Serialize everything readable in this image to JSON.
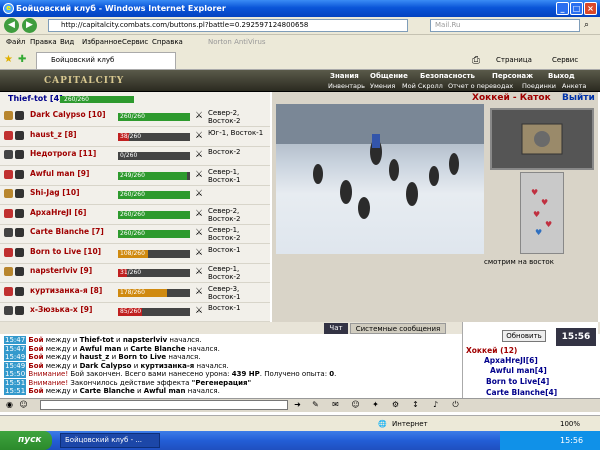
{
  "window": {
    "title": "Бойцовский клуб - Windows Internet Explorer"
  },
  "address": {
    "url": "http://capitalcity.combats.com/buttons.pl?battle=0.292597124800658",
    "search_placeholder": "Mail.Ru"
  },
  "menu": [
    "Файл",
    "Правка",
    "Вид",
    "Избранное",
    "Сервис",
    "Справка"
  ],
  "toolbar": {
    "norton": "Norton AntiVirus",
    "page": "Страница",
    "tools": "Сервис"
  },
  "tab": {
    "label": "Бойцовский клуб"
  },
  "game": {
    "logo": "CAPITALCITY",
    "nav_top": [
      "Знания",
      "Общение",
      "Безопасность",
      "Персонаж",
      "Выход"
    ],
    "nav_sub": [
      "Инвентарь",
      "Умения",
      "Мой Скролл",
      "Отчет о переводах",
      "Поединки",
      "Анкета"
    ],
    "me": {
      "name": "Thief-tot [4]",
      "hp": "260/260"
    },
    "arena_title": "Хоккей - Каток",
    "exit": "Выйти",
    "look": "смотрим на восток",
    "characters": [
      {
        "name": "Dark Calypso [10]",
        "hp": "260/260",
        "fill": 1.0,
        "color": "#2e9a2e",
        "loc": "Севeр-2, Восток-2"
      },
      {
        "name": "haust_z [8]",
        "hp": "38/260",
        "fill": 0.15,
        "color": "#c02020",
        "loc": "Юг-1, Восток-1"
      },
      {
        "name": "Недотрога [11]",
        "hp": "0/260",
        "fill": 0.0,
        "color": "#c02020",
        "loc": "Восток-2"
      },
      {
        "name": "Awful man [9]",
        "hp": "249/260",
        "fill": 0.96,
        "color": "#2e9a2e",
        "loc": "Север-1, Восток-1"
      },
      {
        "name": "Shi-Jag [10]",
        "hp": "260/260",
        "fill": 1.0,
        "color": "#2e9a2e",
        "loc": ""
      },
      {
        "name": "АрхаНreJI [6]",
        "hp": "260/260",
        "fill": 1.0,
        "color": "#2e9a2e",
        "loc": "Север-2, Восток-2"
      },
      {
        "name": "Carte Blanche [7]",
        "hp": "260/260",
        "fill": 1.0,
        "color": "#2e9a2e",
        "loc": "Север-1, Восток-2"
      },
      {
        "name": "Born to Live [10]",
        "hp": "108/260",
        "fill": 0.42,
        "color": "#d08a10",
        "loc": "Восток-1"
      },
      {
        "name": "napsterlviv [9]",
        "hp": "31/260",
        "fill": 0.12,
        "color": "#c02020",
        "loc": "Север-1, Восток-2"
      },
      {
        "name": "куртизанка-я [8]",
        "hp": "178/260",
        "fill": 0.68,
        "color": "#d08a10",
        "loc": "Север-3, Восток-1"
      },
      {
        "name": "х-Зюзька-х [9]",
        "hp": "85/260",
        "fill": 0.33,
        "color": "#c02020",
        "loc": "Восток-1"
      }
    ],
    "chat_tabs": [
      "Чат",
      "Системные сообщения"
    ],
    "chat": [
      {
        "t": "15:47",
        "pre": "Бой",
        "mid": " между и ",
        "a": "Thief-tot",
        "and": " и ",
        "b": "napsterlviv",
        "post": " начался."
      },
      {
        "t": "15:47",
        "pre": "Бой",
        "mid": " между и ",
        "a": "Awful man",
        "and": " и ",
        "b": "Carte Blanche",
        "post": " начался."
      },
      {
        "t": "15:49",
        "pre": "Бой",
        "mid": " между и ",
        "a": "haust_z",
        "and": " и ",
        "b": "Born to Live",
        "post": " начался."
      },
      {
        "t": "15:49",
        "pre": "Бой",
        "mid": " между и ",
        "a": "Dark Calypso",
        "and": " и ",
        "b": "куртизанка-я",
        "post": " начался."
      },
      {
        "t": "15:50",
        "pre": "Внимание!",
        "mid": " Бой закончен. Всего вами нанесено урона: ",
        "a": "439 HP",
        "and": ". Получено опыта: ",
        "b": "0",
        "post": "."
      },
      {
        "t": "15:51",
        "pre": "Внимание!",
        "mid": " Закончилось действие эффекта ",
        "a": "\"Регенерация\"",
        "and": "",
        "b": "",
        "post": ""
      },
      {
        "t": "15:51",
        "pre": "Бой",
        "mid": " между и ",
        "a": "Carte Blanche",
        "and": " и ",
        "b": "Awful man",
        "post": " начался."
      }
    ],
    "online": {
      "refresh": "Обновить",
      "clock": "15:56",
      "room": "Хоккей (12)",
      "users": [
        "АрхаНreJI[6]",
        "Awful man[4]",
        "Born to Live[4]",
        "Carte Blanche[4]"
      ]
    }
  },
  "status": {
    "zone": "Интернет",
    "zoom": "100%"
  },
  "taskbar": {
    "start": "пуск",
    "task": "Бойцовский клуб - ...",
    "clock": "15:56"
  }
}
